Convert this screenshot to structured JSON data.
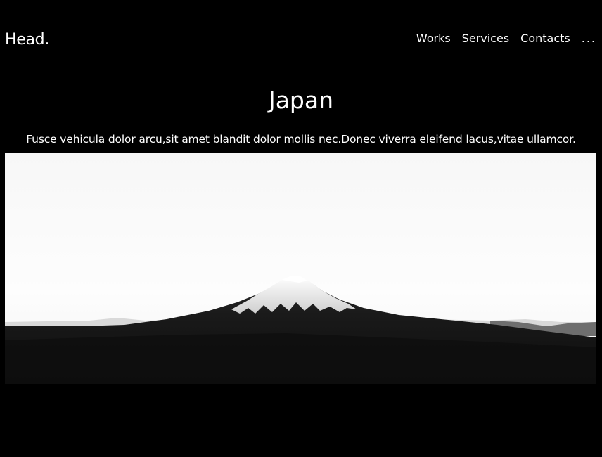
{
  "header": {
    "logo": "Head.",
    "nav": {
      "works": "Works",
      "services": "Services",
      "contacts": "Contacts",
      "more": "..."
    }
  },
  "main": {
    "title": "Japan",
    "subtitle": "Fusce vehicula dolor arcu,sit amet blandit dolor mollis nec.Donec viverra eleifend lacus,vitae ullamcor.",
    "hero_image": "mountain-photo"
  },
  "colors": {
    "background": "#000000",
    "text": "#ffffff"
  }
}
